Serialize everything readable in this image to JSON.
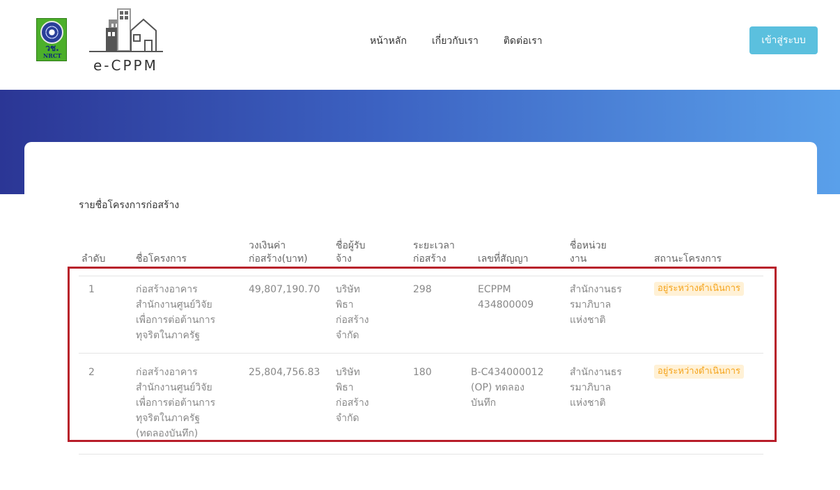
{
  "header": {
    "nrct_abbr": "วช.",
    "nrct_abbr_en": "NRCT",
    "brand": "e-CPPM",
    "nav": [
      "หน้าหลัก",
      "เกี่ยวกับเรา",
      "ติดต่อเรา"
    ],
    "login_label": "เข้าสู่ระบบ"
  },
  "colors": {
    "banner_start": "#2b3695",
    "banner_end": "#5aa0ea",
    "login_button": "#5bc0de",
    "status_text": "#f5a41c",
    "status_bg": "#fff1d6",
    "highlight_border": "#b81e2a"
  },
  "main": {
    "list_title": "รายชื่อโครงการก่อสร้าง",
    "columns": {
      "no": [
        "ลำดับ"
      ],
      "name": [
        "ชื่อโครงการ"
      ],
      "budget": [
        "วงเงินค่า",
        "ก่อสร้าง(บาท)"
      ],
      "contractor": [
        "ชื่อผู้รับ",
        "จ้าง"
      ],
      "duration": [
        "ระยะเวลา",
        "ก่อสร้าง"
      ],
      "contract_no": [
        "เลขที่สัญญา"
      ],
      "agency": [
        "ชื่อหน่วย",
        "งาน"
      ],
      "status": [
        "สถานะโครงการ"
      ]
    },
    "rows": [
      {
        "no": "1",
        "name": [
          "ก่อสร้างอาคาร",
          "สำนักงานศูนย์วิจัย",
          "เพื่อการต่อต้านการ",
          "ทุจริตในภาครัฐ"
        ],
        "budget": "49,807,190.70",
        "contractor": [
          "บริษัท",
          "พิธา",
          "ก่อสร้าง",
          "จำกัด"
        ],
        "duration": "298",
        "contract_no": [
          "ECPPM",
          "434800009"
        ],
        "agency": [
          "สำนักงานธร",
          "รมาภิบาล",
          "แห่งชาติ"
        ],
        "status": "อยู่ระหว่างดำเนินการ"
      },
      {
        "no": "2",
        "name": [
          "ก่อสร้างอาคาร",
          "สำนักงานศูนย์วิจัย",
          "เพื่อการต่อต้านการ",
          "ทุจริตในภาครัฐ",
          "(ทดลองบันทึก)"
        ],
        "budget": "25,804,756.83",
        "contractor": [
          "บริษัท",
          "พิธา",
          "ก่อสร้าง",
          "จำกัด"
        ],
        "duration": "180",
        "contract_no": [
          "B-C434000012",
          "(OP) ทดลอง",
          "บันทึก"
        ],
        "agency": [
          "สำนักงานธร",
          "รมาภิบาล",
          "แห่งชาติ"
        ],
        "status": "อยู่ระหว่างดำเนินการ"
      }
    ]
  }
}
